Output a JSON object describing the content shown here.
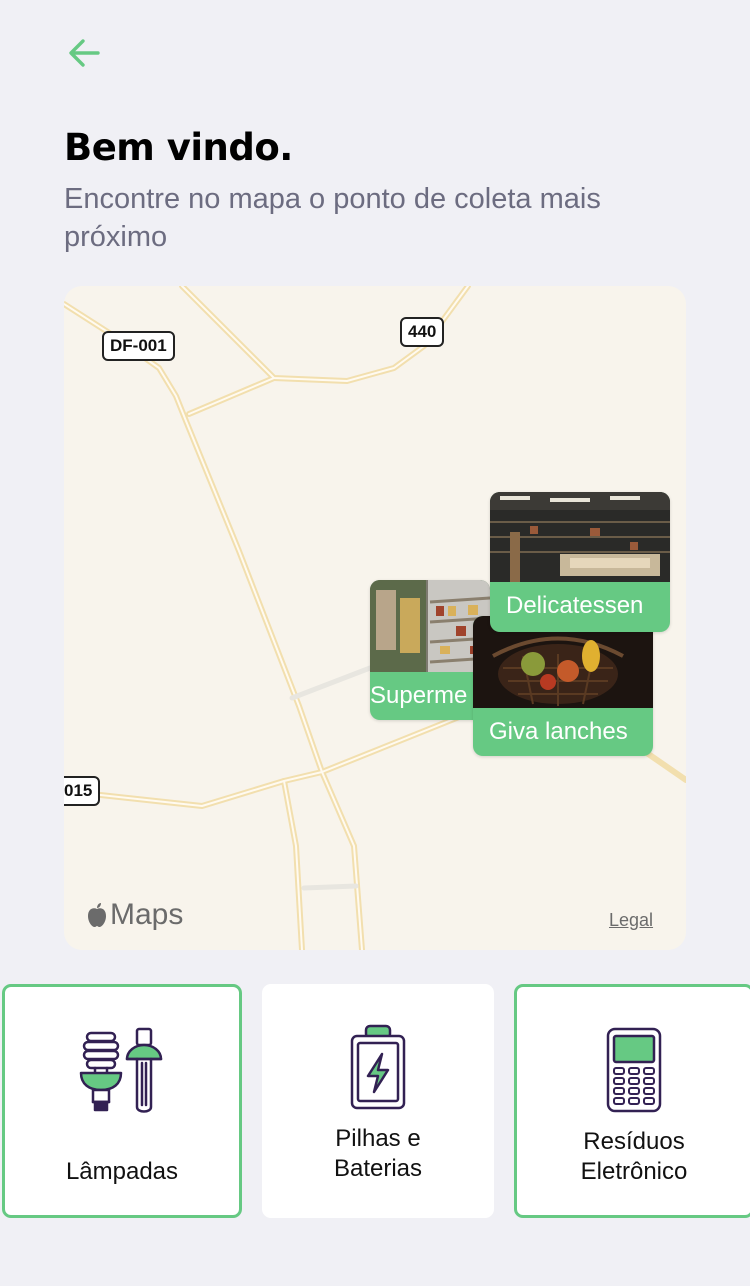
{
  "header": {
    "back_icon": "arrow-left-icon",
    "title": "Bem vindo.",
    "subtitle": "Encontre no mapa o ponto de coleta mais próximo"
  },
  "map": {
    "provider_label": "Maps",
    "legal_label": "Legal",
    "road_shields": [
      "DF-001",
      "440",
      "015"
    ],
    "markers": [
      {
        "label": "Delicatessen",
        "photo": "deli-counter-photo"
      },
      {
        "label": "Superme",
        "photo": "supermarket-shelves-photo"
      },
      {
        "label": "Giva lanches",
        "photo": "grocery-basket-photo"
      }
    ]
  },
  "categories": [
    {
      "label": "Lâmpadas",
      "icon": "lamps-icon",
      "selected": true
    },
    {
      "label": "Pilhas e Baterias",
      "icon": "battery-icon",
      "selected": false
    },
    {
      "label": "Resíduos Eletrônico",
      "icon": "electronics-icon",
      "selected": true
    }
  ],
  "colors": {
    "accent": "#66c983",
    "background": "#f0f0f5",
    "icon_stroke": "#322153",
    "subtitle": "#6c6c80"
  }
}
